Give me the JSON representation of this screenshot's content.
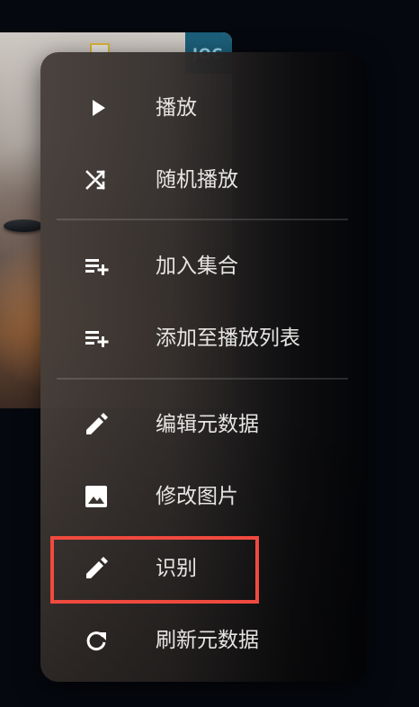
{
  "poster": {
    "badge_text": "JOC"
  },
  "menu": {
    "items": [
      {
        "label": "播放",
        "icon": "play-icon"
      },
      {
        "label": "随机播放",
        "icon": "shuffle-icon"
      },
      {
        "label": "加入集合",
        "icon": "playlist-add-icon"
      },
      {
        "label": "添加至播放列表",
        "icon": "playlist-add-icon"
      },
      {
        "label": "编辑元数据",
        "icon": "pencil-icon"
      },
      {
        "label": "修改图片",
        "icon": "image-icon"
      },
      {
        "label": "识别",
        "icon": "pencil-icon"
      },
      {
        "label": "刷新元数据",
        "icon": "refresh-icon"
      }
    ]
  },
  "colors": {
    "highlight": "#f04a3e",
    "text": "#e7e5e3",
    "page_background": "#05080f"
  }
}
